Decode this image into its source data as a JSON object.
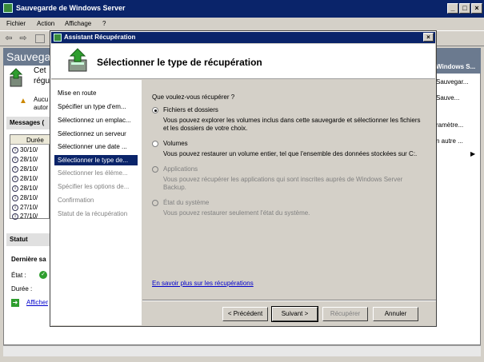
{
  "main": {
    "title": "Sauvegarde de Windows Server",
    "menu": [
      "Fichier",
      "Action",
      "Affichage",
      "?"
    ],
    "header_text": "Sauvegar",
    "left_texts": [
      "Cet",
      "régu",
      "Aucu",
      "autor"
    ],
    "messages_label": "Messages (",
    "list_header": "Durée",
    "list_rows": [
      "30/10/",
      "28/10/",
      "28/10/",
      "28/10/",
      "28/10/",
      "28/10/",
      "27/10/",
      "27/10/"
    ],
    "statut_label": "Statut",
    "derniere_label": "Dernière sa",
    "etat_label": "État :",
    "duree_label": "Durée :",
    "afficher_label": "Afficher",
    "right_pane": {
      "header": "Windows S...",
      "items": [
        "Sauvegar...",
        "Sauve...",
        "ramètre...",
        "n autre ..."
      ]
    }
  },
  "wizard": {
    "title": "Assistant Récupération",
    "heading": "Sélectionner le type de récupération",
    "steps": [
      {
        "label": "Mise en route",
        "state": "normal"
      },
      {
        "label": "Spécifier un type d'em...",
        "state": "normal"
      },
      {
        "label": "Sélectionnez un emplac...",
        "state": "normal"
      },
      {
        "label": "Sélectionnez un serveur",
        "state": "normal"
      },
      {
        "label": "Sélectionner une date ...",
        "state": "normal"
      },
      {
        "label": "Sélectionner le type de...",
        "state": "selected"
      },
      {
        "label": "Sélectionner les éléme...",
        "state": "disabled"
      },
      {
        "label": "Spécifier les options de...",
        "state": "disabled"
      },
      {
        "label": "Confirmation",
        "state": "disabled"
      },
      {
        "label": "Statut de la récupération",
        "state": "disabled"
      }
    ],
    "question": "Que voulez-vous récupérer ?",
    "options": [
      {
        "label": "Fichiers et dossiers",
        "desc": "Vous pouvez explorer les volumes inclus dans cette sauvegarde et sélectionner les fichiers et les dossiers de votre choix.",
        "checked": true,
        "enabled": true
      },
      {
        "label": "Volumes",
        "desc": "Vous pouvez restaurer un volume entier, tel que l'ensemble des données stockées sur C:.",
        "checked": false,
        "enabled": true
      },
      {
        "label": "Applications",
        "desc": "Vous pouvez récupérer les applications qui sont inscrites auprès de Windows Server Backup.",
        "checked": false,
        "enabled": false
      },
      {
        "label": "État du système",
        "desc": "Vous pouvez restaurer seulement l'état du système.",
        "checked": false,
        "enabled": false
      }
    ],
    "link": "En savoir plus sur les récupérations",
    "buttons": {
      "previous": "< Précédent",
      "next": "Suivant >",
      "recover": "Récupérer",
      "cancel": "Annuler"
    }
  }
}
